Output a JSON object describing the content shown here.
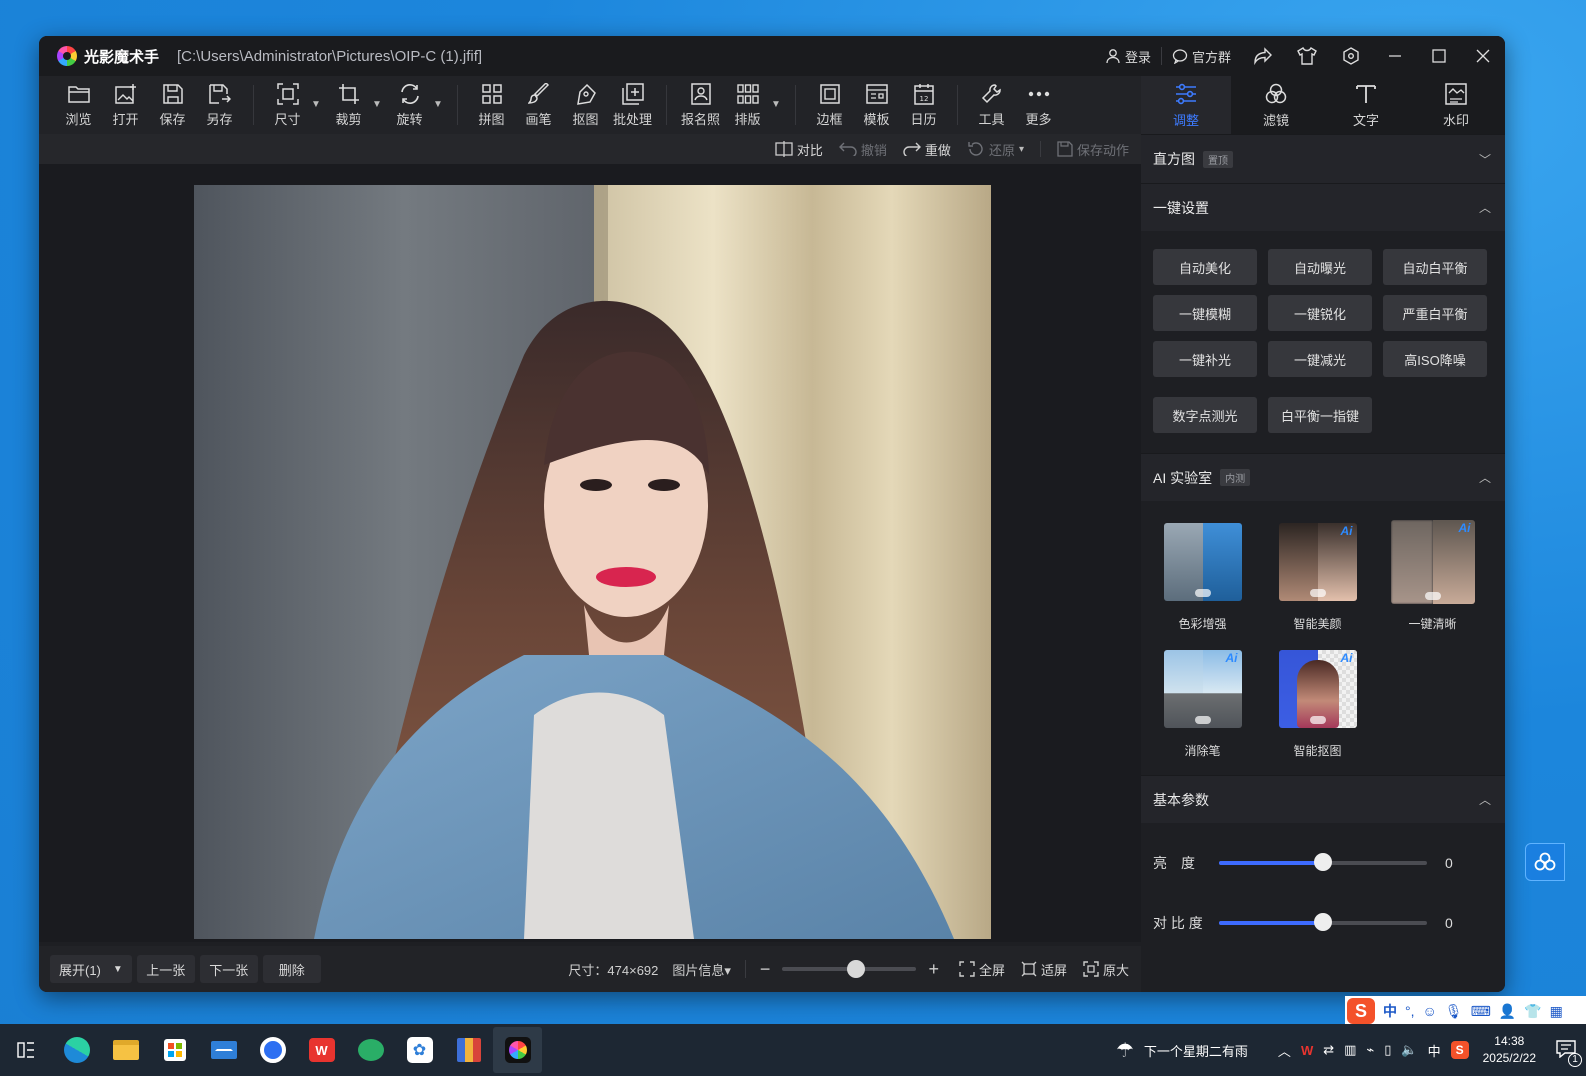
{
  "window": {
    "app_name": "光影魔术手",
    "file_path": "[C:\\Users\\Administrator\\Pictures\\OIP-C (1).jfif]",
    "login_label": "登录",
    "group_label": "官方群"
  },
  "toolbar": {
    "browse": "浏览",
    "open": "打开",
    "save": "保存",
    "save_as": "另存",
    "size": "尺寸",
    "crop": "裁剪",
    "rotate": "旋转",
    "collage": "拼图",
    "brush": "画笔",
    "cutout": "抠图",
    "batch": "批处理",
    "id_photo": "报名照",
    "layout": "排版",
    "border": "边框",
    "template": "模板",
    "calendar": "日历",
    "tools": "工具",
    "more": "更多"
  },
  "actions": {
    "compare": "对比",
    "undo": "撤销",
    "redo": "重做",
    "restore": "还原",
    "save_action": "保存动作"
  },
  "bottombar": {
    "expand": "展开(1)",
    "prev": "上一张",
    "next": "下一张",
    "delete": "删除",
    "size_info": "尺寸：474×692",
    "image_info": "图片信息▾",
    "fullscreen": "全屏",
    "fit": "适屏",
    "original": "原大",
    "zoom_level": 0.55
  },
  "panel": {
    "tabs": [
      {
        "label": "调整",
        "icon": "sliders-icon"
      },
      {
        "label": "滤镜",
        "icon": "filter-icon"
      },
      {
        "label": "文字",
        "icon": "text-icon"
      },
      {
        "label": "水印",
        "icon": "watermark-icon"
      }
    ],
    "histogram": {
      "title": "直方图",
      "tag": "置顶"
    },
    "quick": {
      "title": "一键设置",
      "buttons": [
        "自动美化",
        "自动曝光",
        "自动白平衡",
        "一键模糊",
        "一键锐化",
        "严重白平衡",
        "一键补光",
        "一键减光",
        "高ISO降噪",
        "数字点测光",
        "白平衡一指键"
      ]
    },
    "ai_lab": {
      "title": "AI 实验室",
      "tag": "内测",
      "items": [
        "色彩增强",
        "智能美颜",
        "一键清晰",
        "消除笔",
        "智能抠图"
      ],
      "badge": "Ai"
    },
    "basic": {
      "title": "基本参数",
      "sliders": [
        {
          "name": "亮　度",
          "value": "0",
          "level": 0.5
        },
        {
          "name": "对 比 度",
          "value": "0",
          "level": 0.5
        }
      ]
    }
  },
  "ime": {
    "lang": "中",
    "punct": "°,"
  },
  "taskbar": {
    "weather": "下一个星期二有雨",
    "lang": "中",
    "time": "14:38",
    "date": "2025/2/22",
    "notification_count": "1"
  },
  "colors": {
    "accent": "#3d7bff",
    "window_bg": "#1e1f23",
    "button_bg": "#36373c"
  }
}
